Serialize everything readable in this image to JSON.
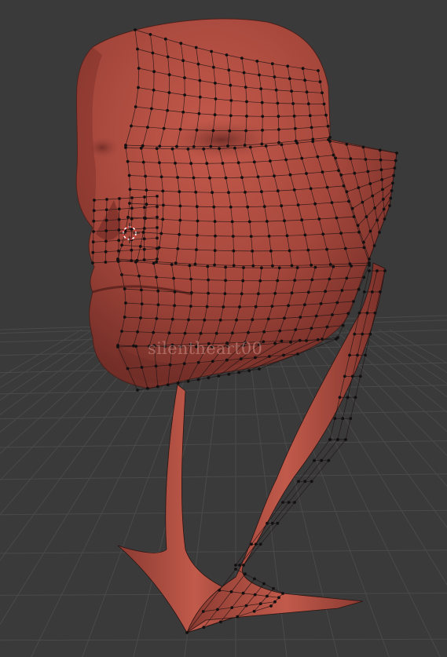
{
  "viewport": {
    "background": "#3a3a3a",
    "grid_color": "#4a4a4a",
    "mesh_color": "#b5483e",
    "wire_color": "#1e1414",
    "vertex_color": "#121010",
    "cursor_colors": [
      "#ffffff",
      "#d83c3c"
    ]
  },
  "object": {
    "type": "retopology face mesh with support stand",
    "watermark": "silentheart00"
  },
  "icons": [
    "3d-cursor-icon"
  ]
}
